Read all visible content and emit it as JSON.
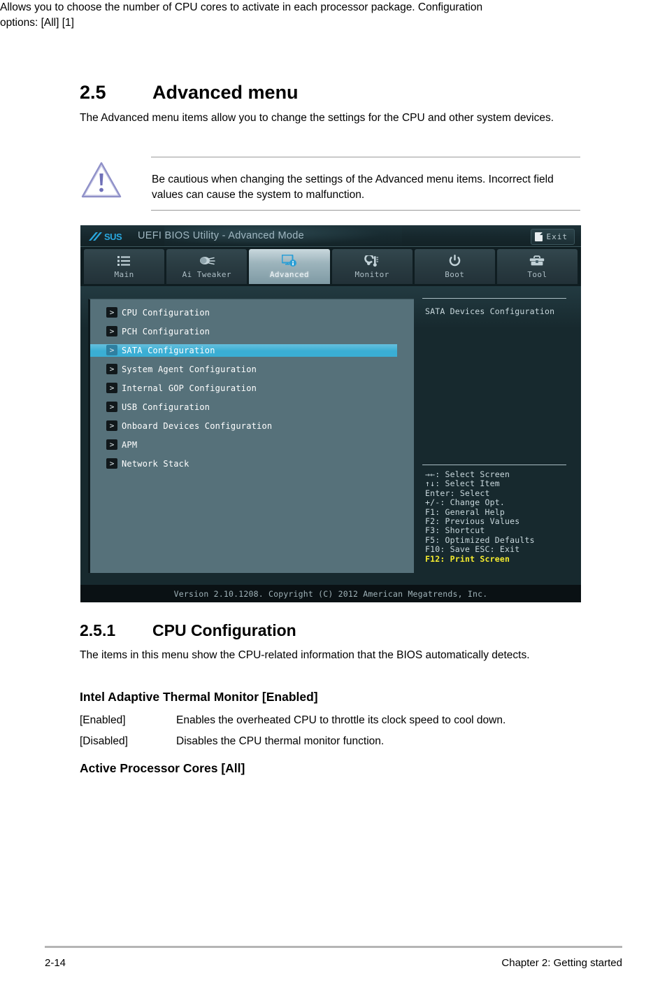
{
  "document": {
    "section": {
      "number": "2.5",
      "title": "Advanced menu",
      "intro": "The Advanced menu items allow you to change the settings for the CPU and other system devices."
    },
    "note": {
      "icon": "warning-triangle-icon",
      "text": "Be cautious when changing the settings of the Advanced menu items. Incorrect field values can cause the system to malfunction."
    },
    "subsection": {
      "number": "2.5.1",
      "title": "CPU Configuration",
      "intro": "The items in this menu show the CPU-related information that the BIOS automatically detects."
    },
    "thermal": {
      "heading": "Intel Adaptive Thermal Monitor [Enabled]",
      "options": [
        {
          "key": "[Enabled]",
          "desc": "Enables the overheated CPU to throttle its clock speed to cool down."
        },
        {
          "key": "[Disabled]",
          "desc": "Disables the CPU thermal monitor function."
        }
      ]
    },
    "cores": {
      "heading": "Active Processor Cores [All]",
      "description": "Allows you to choose the number of CPU cores to activate in each processor package. Configuration options: [All] [1]"
    },
    "footer": {
      "page_number": "2-14",
      "chapter": "Chapter 2: Getting started"
    }
  },
  "bios": {
    "brand": "ASUS",
    "title": "UEFI BIOS Utility - Advanced Mode",
    "exit_label": "Exit",
    "exit_icon": "exit-door-icon",
    "tabs": [
      {
        "label": "Main",
        "icon": "list-icon",
        "active": false
      },
      {
        "label": "Ai Tweaker",
        "icon": "tuner-knob-icon",
        "active": false
      },
      {
        "label": "Advanced",
        "icon": "monitor-info-icon",
        "active": true
      },
      {
        "label": "Monitor",
        "icon": "thermometer-icon",
        "active": false
      },
      {
        "label": "Boot",
        "icon": "power-icon",
        "active": false
      },
      {
        "label": "Tool",
        "icon": "toolbox-icon",
        "active": false
      }
    ],
    "menu_items": [
      {
        "label": "CPU Configuration",
        "selected": false
      },
      {
        "label": "PCH Configuration",
        "selected": false
      },
      {
        "label": "SATA Configuration",
        "selected": true
      },
      {
        "label": "System Agent Configuration",
        "selected": false
      },
      {
        "label": "Internal GOP Configuration",
        "selected": false
      },
      {
        "label": "USB Configuration",
        "selected": false
      },
      {
        "label": "Onboard Devices Configuration",
        "selected": false
      },
      {
        "label": "APM",
        "selected": false
      },
      {
        "label": "Network Stack",
        "selected": false
      }
    ],
    "arrow_glyph": ">",
    "help_text": "SATA Devices Configuration",
    "key_legend": [
      {
        "text": "→←: Select Screen",
        "highlight": false
      },
      {
        "text": "↑↓: Select Item",
        "highlight": false
      },
      {
        "text": "Enter: Select",
        "highlight": false
      },
      {
        "text": "+/-: Change Opt.",
        "highlight": false
      },
      {
        "text": "F1: General Help",
        "highlight": false
      },
      {
        "text": "F2: Previous Values",
        "highlight": false
      },
      {
        "text": "F3: Shortcut",
        "highlight": false
      },
      {
        "text": "F5: Optimized Defaults",
        "highlight": false
      },
      {
        "text": "F10: Save  ESC: Exit",
        "highlight": false
      },
      {
        "text": "F12: Print Screen",
        "highlight": true
      }
    ],
    "version": "Version 2.10.1208. Copyright (C) 2012 American Megatrends, Inc.",
    "colors": {
      "selected_row": "#3aaed4",
      "highlight_key": "#f5ec2f",
      "panel_bg": "#56717a",
      "body_bg": "#17292e"
    }
  }
}
